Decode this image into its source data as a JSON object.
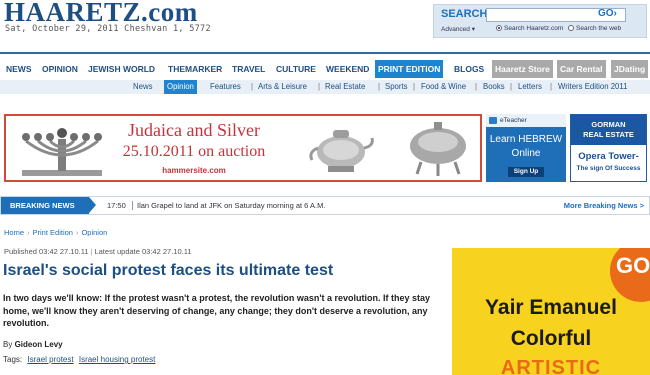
{
  "site": {
    "logo": "HAARETZ.com",
    "dateline": "Sat, October 29, 2011 Cheshvan 1, 5772"
  },
  "search": {
    "label": "SEARCH",
    "go": "GO›",
    "advanced": "Advanced ▾",
    "option_haaretz": "Search Haaretz.com",
    "option_web": "Search the web"
  },
  "nav": {
    "main": [
      "NEWS",
      "OPINION",
      "JEWISH WORLD",
      "THEMARKER",
      "TRAVEL",
      "CULTURE",
      "WEEKEND",
      "PRINT EDITION",
      "BLOGS",
      "Haaretz Store",
      "Car Rental",
      "JDating"
    ],
    "sub": [
      "News",
      "Opinion",
      "Features",
      "Arts & Leisure",
      "Real Estate",
      "Sports",
      "Food & Wine",
      "Books",
      "Letters",
      "Writers Edition 2011"
    ]
  },
  "ads": {
    "judaica_title": "Judaica and Silver",
    "judaica_date": "25.10.2011 on auction",
    "judaica_site": "hammersite.com",
    "hebrew_brand": "eTeacher",
    "hebrew_line1": "Learn HEBREW",
    "hebrew_line2": "Online",
    "hebrew_btn": "Sign Up",
    "gorman_top1": "GORMAN",
    "gorman_top2": "REAL ESTATE",
    "gorman_name": "Opera Tower-",
    "gorman_slogan": "The sign Of Success",
    "right_go": "GO",
    "right_line1": "Yair Emanuel",
    "right_line2": "Colorful",
    "right_line3": "ARTISTIC"
  },
  "breaking": {
    "label": "BREAKING NEWS",
    "time": "17:50",
    "text": "Ilan Grapel to land at JFK on Saturday morning at 6 A.M.",
    "more": "More Breaking News >"
  },
  "breadcrumb": [
    "Home",
    "Print Edition",
    "Opinion"
  ],
  "article": {
    "published": "Published 03:42 27.10.11",
    "updated": "Latest update 03:42 27.10.11",
    "headline": "Israel's social protest faces its ultimate test",
    "summary": "In two days we'll know: If the protest wasn't a protest, the revolution wasn't a revolution. If they stay home, we'll know they aren't deserving of change, any change; they don't deserve a revolution, any revolution.",
    "byline_prefix": "By",
    "author": "Gideon Levy",
    "tags_label": "Tags:",
    "tags": [
      "Israel protest",
      "Israel housing protest"
    ]
  },
  "colors": {
    "brand_blue": "#1d4f82",
    "link_blue": "#1b6fc0",
    "active_tab": "#1f84d0",
    "ad_red": "#c8323a",
    "ad_yellow": "#f7d21e"
  }
}
